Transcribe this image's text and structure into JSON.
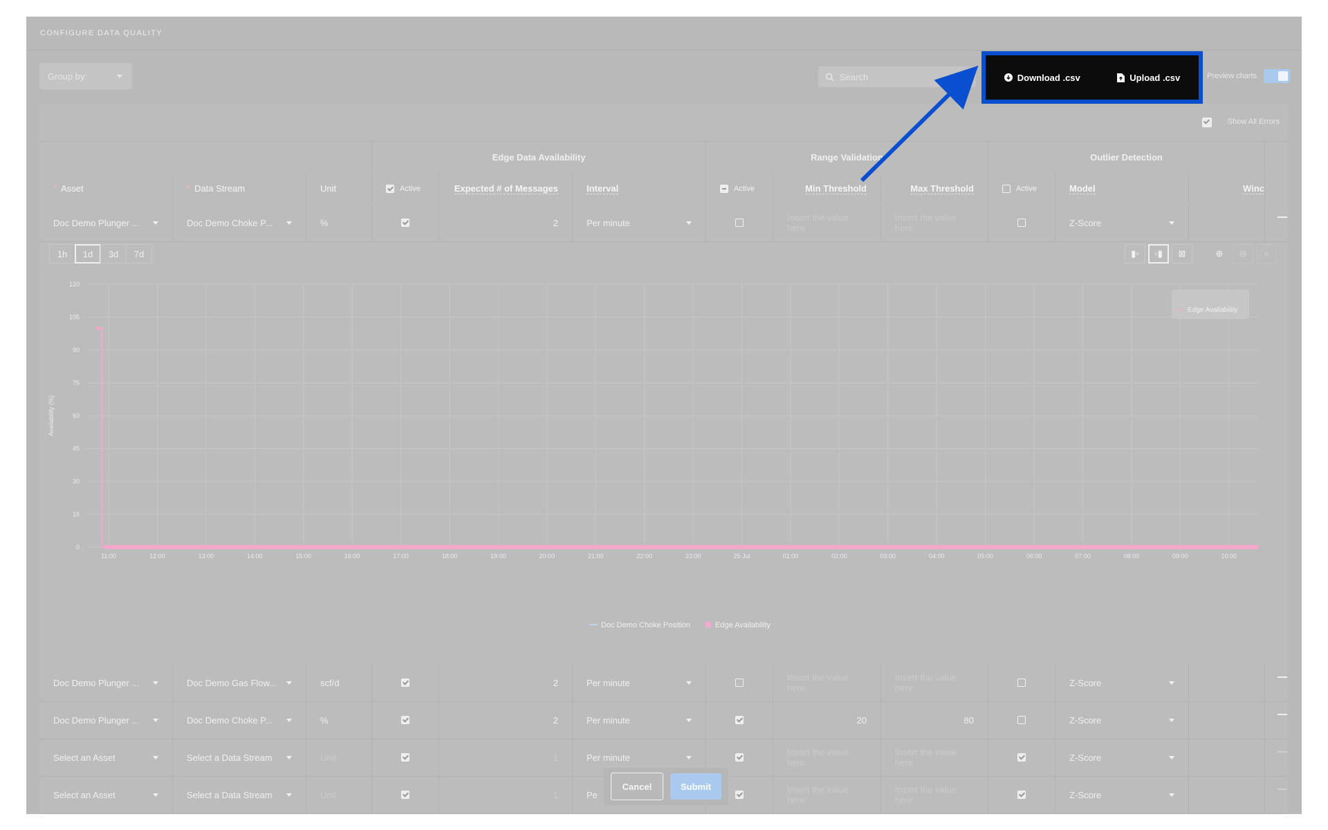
{
  "page": {
    "title": "CONFIGURE DATA QUALITY"
  },
  "toolbar": {
    "group_by": "Group by:",
    "search_placeholder": "Search",
    "download_label": "Download .csv",
    "upload_label": "Upload .csv",
    "preview_label": "Preview charts",
    "preview_on": true
  },
  "table": {
    "show_all_errors": "Show All Errors",
    "groups": [
      "Edge Data Availability",
      "Range Validation",
      "Outlier Detection"
    ],
    "columns": {
      "asset": "Asset",
      "data_stream": "Data Stream",
      "unit": "Unit",
      "active": "Active",
      "expected": "Expected # of Messages",
      "interval": "Interval",
      "min": "Min Threshold",
      "max": "Max Threshold",
      "model": "Model",
      "window": "Winc"
    },
    "rows": [
      {
        "asset": "Doc Demo Plunger ...",
        "stream": "Doc Demo Choke P...",
        "unit": "%",
        "eda": true,
        "expected": "2",
        "interval": "Per minute",
        "rv": false,
        "min": "Insert the value here",
        "max": "Insert the value here",
        "od": false,
        "model": "Z-Score"
      },
      {
        "asset": "Doc Demo Plunger ...",
        "stream": "Doc Demo Gas Flow...",
        "unit": "scf/d",
        "eda": true,
        "expected": "2",
        "interval": "Per minute",
        "rv": false,
        "min": "Insert the value here",
        "max": "Insert the value here",
        "od": false,
        "model": "Z-Score"
      },
      {
        "asset": "Doc Demo Plunger ...",
        "stream": "Doc Demo Choke P...",
        "unit": "%",
        "eda": true,
        "expected": "2",
        "interval": "Per minute",
        "rv": true,
        "min": "20",
        "max": "80",
        "od": false,
        "model": "Z-Score"
      },
      {
        "asset": "Select an Asset",
        "stream": "Select a Data Stream",
        "unit": "Unit",
        "eda": true,
        "expected": "1",
        "interval": "Per minute",
        "rv": true,
        "min": "Insert the value here",
        "max": "Insert the value here",
        "od": true,
        "model": "Z-Score"
      },
      {
        "asset": "Select an Asset",
        "stream": "Select a Data Stream",
        "unit": "Unit",
        "eda": true,
        "expected": "1",
        "interval": "Pe",
        "rv": true,
        "min": "Insert the value here",
        "max": "Insert the value here",
        "od": true,
        "model": "Z-Score"
      }
    ]
  },
  "chart_controls": {
    "ranges": [
      "1h",
      "1d",
      "3d",
      "7d"
    ],
    "selected_range": "1d"
  },
  "chart_data": {
    "type": "line",
    "ylabel": "Availability (%)",
    "ylim": [
      0,
      120
    ],
    "yticks": [
      0,
      15,
      30,
      45,
      60,
      75,
      90,
      105,
      120
    ],
    "x_ticks": [
      "11:00",
      "12:00",
      "13:00",
      "14:00",
      "15:00",
      "16:00",
      "17:00",
      "18:00",
      "19:00",
      "20:00",
      "21:00",
      "22:00",
      "23:00",
      "25 Jul",
      "01:00",
      "02:00",
      "03:00",
      "04:00",
      "05:00",
      "06:00",
      "07:00",
      "08:00",
      "09:00",
      "10:00"
    ],
    "series": [
      {
        "name": "Doc Demo Choke Position",
        "color": "#b9d6f2",
        "x": [],
        "y": []
      },
      {
        "name": "Edge Availability",
        "color": "#f5a8cc",
        "x": [
          "10:48",
          "10:52",
          "10:52",
          "10:55"
        ],
        "y": [
          100,
          100,
          0,
          0
        ]
      }
    ],
    "grid": true,
    "legend_placement": "bottom",
    "tooltip_label": "Edge Availability"
  },
  "actions": {
    "cancel": "Cancel",
    "submit": "Submit"
  },
  "colors": {
    "highlight_border": "#0b4fd1",
    "arrow": "#0b4fd1",
    "submit": "#a9c9ef",
    "edge_series": "#f5a8cc"
  }
}
